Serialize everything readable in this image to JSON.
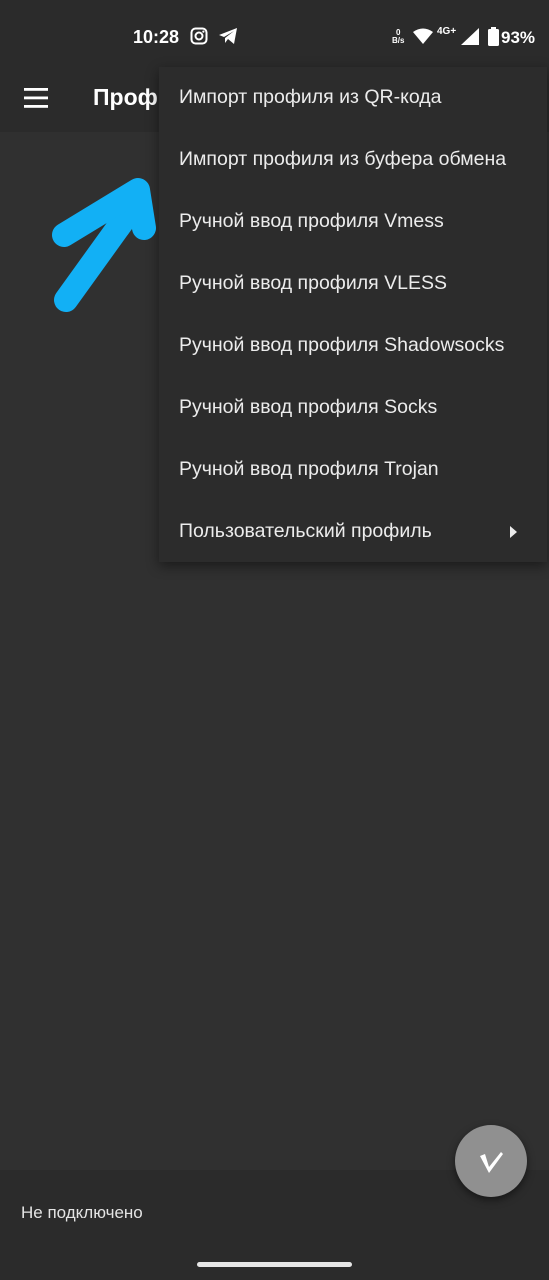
{
  "status_bar": {
    "time": "10:28",
    "icons": [
      "instagram-icon",
      "telegram-icon",
      "wifi-icon",
      "cell-signal-icon",
      "battery-icon"
    ],
    "net_speed_value": "0",
    "net_speed_unit": "B/s",
    "network_type": "4G+",
    "battery_percent": "93%"
  },
  "app_bar": {
    "title": "Проф",
    "menu_icon": "hamburger-menu-icon"
  },
  "dropdown": {
    "items": [
      {
        "label": "Импорт профиля из QR-кода"
      },
      {
        "label": "Импорт профиля из буфера обмена"
      },
      {
        "label": "Ручной ввод профиля Vmess"
      },
      {
        "label": "Ручной ввод профиля VLESS"
      },
      {
        "label": "Ручной ввод профиля Shadowsocks"
      },
      {
        "label": "Ручной ввод профиля Socks"
      },
      {
        "label": "Ручной ввод профиля Trojan"
      },
      {
        "label": "Пользовательский профиль",
        "has_submenu": true
      }
    ]
  },
  "annotation": {
    "icon": "arrow-annotation-icon",
    "color": "#12b0f5"
  },
  "fab": {
    "icon": "v-logo-icon"
  },
  "bottom_bar": {
    "connection_status": "Не подключено"
  },
  "colors": {
    "background": "#303030",
    "bar": "#2b2b2b",
    "menu": "#2c2c2c",
    "fab": "#909090"
  }
}
